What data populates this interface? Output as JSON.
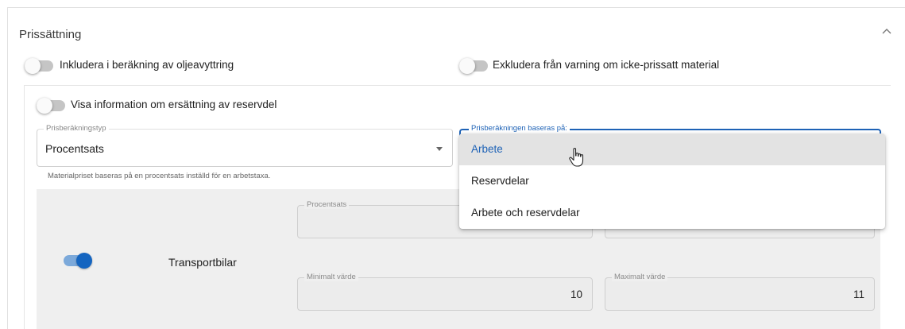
{
  "section": {
    "title": "Prissättning",
    "collapse_icon": "chevron-up-icon"
  },
  "toggles": {
    "oil_disposal": {
      "label": "Inkludera i beräkning av oljeavyttring",
      "on": false
    },
    "unpriced_warning": {
      "label": "Exkludera från varning om icke-prissatt material",
      "on": false
    },
    "spare_part_info": {
      "label": "Visa information om ersättning av reservdel",
      "on": false
    }
  },
  "pricing_type": {
    "legend": "Prisberäkningstyp",
    "value": "Procentsats",
    "helper": "Materialpriset baseras på en procentsats inställd för en arbetstaxa."
  },
  "pricing_basis": {
    "legend": "Prisberäkningen baseras på:",
    "options": [
      "Arbete",
      "Reservdelar",
      "Arbete och reservdelar"
    ],
    "selected": "Arbete"
  },
  "vehicle_row": {
    "label": "Transportbilar",
    "toggle_on": true,
    "percent_legend": "Procentsats",
    "min_legend": "Minimalt värde",
    "min_value": "10",
    "max_legend": "Maximalt värde",
    "max_value": "11"
  },
  "colors": {
    "accent": "#1e62b6",
    "disabled_bg": "#efefef",
    "menu_selected_bg": "#e3e3e3"
  }
}
